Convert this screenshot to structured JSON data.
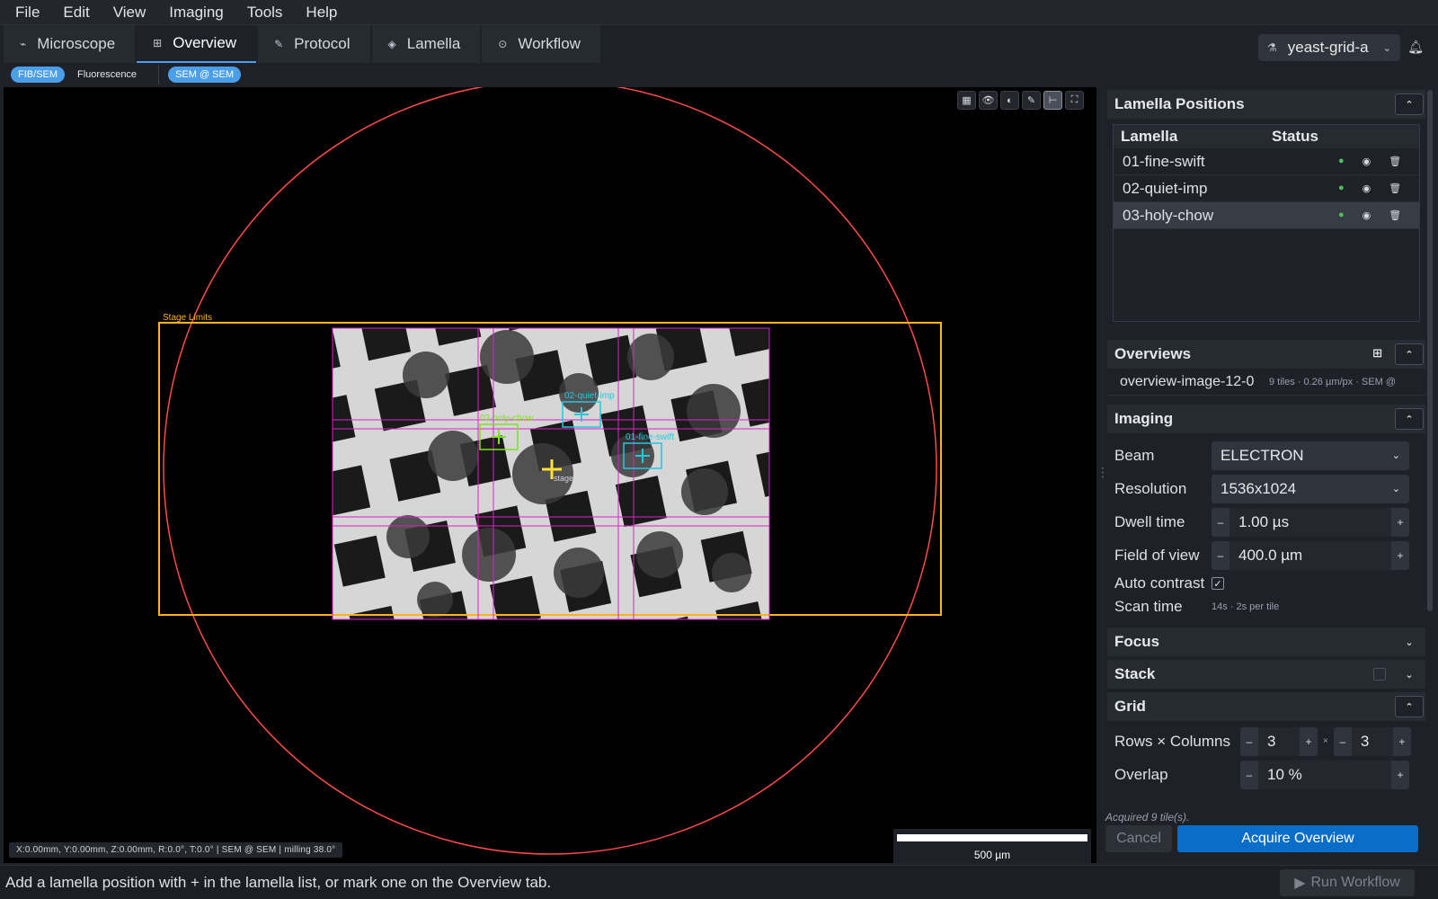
{
  "menu": [
    "File",
    "Edit",
    "View",
    "Imaging",
    "Tools",
    "Help"
  ],
  "tabs": [
    {
      "label": "Microscope",
      "icon": "⌁"
    },
    {
      "label": "Overview",
      "icon": "⊞"
    },
    {
      "label": "Protocol",
      "icon": "✎"
    },
    {
      "label": "Lamella",
      "icon": "◈"
    },
    {
      "label": "Workflow",
      "icon": "⊙"
    }
  ],
  "project": {
    "name": "yeast-grid-a",
    "icon": "⚗"
  },
  "modes": {
    "fibsem": "FIB/SEM",
    "fluorescence": "Fluorescence",
    "beam": "SEM @ SEM"
  },
  "viewer": {
    "stage_limits_label": "Stage Limits",
    "stage_label": "stage",
    "coords": "X:0.00mm, Y:0.00mm, Z:0.00mm, R:0.0°, T:0.0°   |   SEM @ SEM   |   milling 38.0°",
    "scale_label": "500 µm",
    "markers": [
      {
        "label": "03-holy-chow",
        "color": "#7fe027"
      },
      {
        "label": "02-quiet-imp",
        "color": "#27c6e0"
      },
      {
        "label": "01-fine-swift",
        "color": "#27c6e0"
      }
    ],
    "colors": {
      "stage_circle": "#ff4b4b",
      "stage_limits": "#ffb31a",
      "tile_grid": "#e020c8",
      "stage_cross": "#ffe033"
    }
  },
  "lamella_panel": {
    "title": "Lamella Positions",
    "col_lamella": "Lamella",
    "col_status": "Status",
    "rows": [
      {
        "name": "01-fine-swift",
        "status": "ok"
      },
      {
        "name": "02-quiet-imp",
        "status": "ok"
      },
      {
        "name": "03-holy-chow",
        "status": "ok"
      }
    ]
  },
  "overviews": {
    "title": "Overviews",
    "items": [
      {
        "name": "overview-image-12-0",
        "meta": "9 tiles · 0.26 µm/px · SEM @"
      }
    ]
  },
  "imaging": {
    "title": "Imaging",
    "beam_label": "Beam",
    "beam_value": "ELECTRON",
    "resolution_label": "Resolution",
    "resolution_value": "1536x1024",
    "dwell_label": "Dwell time",
    "dwell_value": "1.00  µs",
    "fov_label": "Field of view",
    "fov_value": "400.0  µm",
    "autocontrast_label": "Auto contrast",
    "autocontrast_checked": "✓",
    "scantime_label": "Scan time",
    "scantime_value": "14s  ·  2s per tile"
  },
  "focus": {
    "title": "Focus"
  },
  "stack": {
    "title": "Stack"
  },
  "grid": {
    "title": "Grid",
    "rows_cols_label": "Rows × Columns",
    "rows": "3",
    "cols": "3",
    "times": "×",
    "overlap_label": "Overlap",
    "overlap_value": "10  %"
  },
  "acquire": {
    "status": "Acquired 9 tile(s).",
    "cancel": "Cancel",
    "acquire": "Acquire Overview"
  },
  "statusbar": {
    "message": "Add a lamella position with + in the lamella list, or mark one on the Overview tab.",
    "run": "Run Workflow"
  }
}
